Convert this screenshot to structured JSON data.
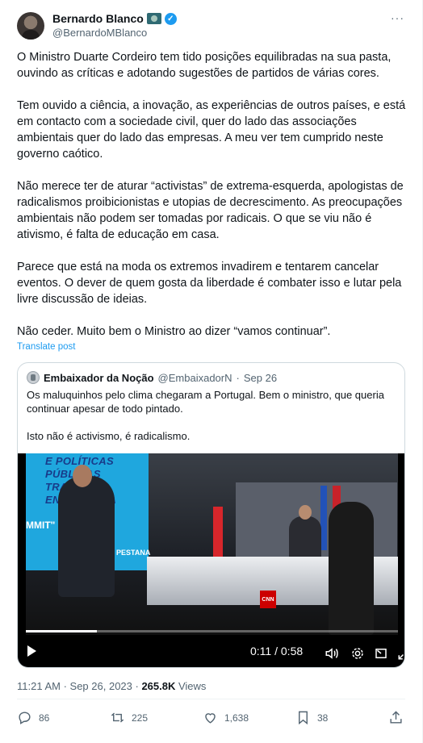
{
  "author": {
    "display_name": "Bernardo Blanco",
    "handle": "@BernardoMBlanco",
    "avatar_icon": "avatar-photo",
    "flag_icon": "flag-emoji-icon",
    "verified_icon": "verified-badge-icon"
  },
  "more_icon": "more-options-icon",
  "text": {
    "p1": "O Ministro Duarte Cordeiro tem tido posições equilibradas na sua pasta,\nouvindo as críticas e adotando sugestões de partidos de várias cores.",
    "p2": "Tem ouvido a ciência, a inovação, as experiências de outros países, e está\nem contacto com a sociedade civil, quer do lado das associações\nambientais quer do lado das empresas. A meu ver tem cumprido neste\ngoverno caótico.",
    "p3": "Não merece ter de aturar “activistas” de extrema-esquerda, apologistas de\nradicalismos proibicionistas e utopias de decrescimento. As preocupações\nambientais não podem ser tomadas por radicais. O que se viu não é\nativismo, é falta de educação em casa.",
    "p4": "Parece que está na moda os extremos invadirem e tentarem cancelar\neventos. O dever de quem gosta da liberdade é combater isso e lutar pela\nlivre discussão de ideias.",
    "p5": "Não ceder. Muito bem o Ministro ao dizer “vamos continuar”."
  },
  "translate_label": "Translate post",
  "quote": {
    "display_name": "Embaixador da Noção",
    "handle": "@EmbaixadorN",
    "separator": "·",
    "date": "Sep 26",
    "p1": "Os maluquinhos pelo clima chegaram a Portugal. Bem o ministro, que queria\ncontinuar apesar de todo pintado.",
    "p2": "Isto não é activismo, é radicalismo.",
    "video": {
      "screen_line1": "E POLÍTICAS PÚBLICAS",
      "screen_line2": "TRANSIÇÃO ENERGÉTICA",
      "screen_sub": "MMIT\"",
      "screen_logo": "PESTANA",
      "desk_logo": "CNN",
      "progress": 0.19,
      "time_current": "0:11",
      "time_sep": " / ",
      "time_total": "0:58",
      "icons": [
        "play-icon",
        "volume-icon",
        "settings-icon",
        "picture-in-picture-icon",
        "fullscreen-icon"
      ]
    }
  },
  "footer": {
    "time": "11:21 AM",
    "dot": " · ",
    "date": "Sep 26, 2023",
    "dot2": " · ",
    "views_count": "265.8K",
    "views_label": " Views"
  },
  "actions": {
    "replies": "86",
    "reposts": "225",
    "likes": "1,638",
    "bookmarks": "38"
  },
  "colors": {
    "accent": "#1d9bf0",
    "text": "#0f1419",
    "secondary": "#536471",
    "border": "#cfd9de"
  }
}
